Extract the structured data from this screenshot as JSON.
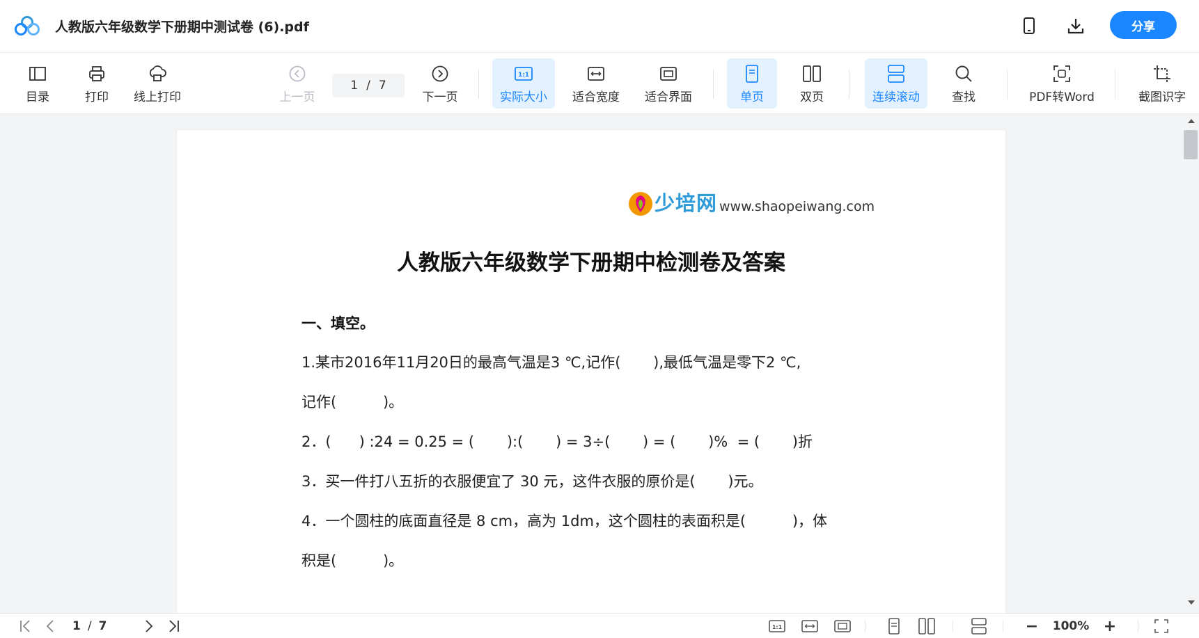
{
  "window": {
    "title": "人教版六年级数学下册期中测试卷 (6).pdf",
    "share_label": "分享",
    "accent_color": "#1a86ff"
  },
  "toolbar": {
    "toc": "目录",
    "print": "打印",
    "online_print": "线上打印",
    "prev_page": "上一页",
    "page_current": "1",
    "page_sep": "/",
    "page_total": "7",
    "next_page": "下一页",
    "actual_size": "实际大小",
    "fit_width": "适合宽度",
    "fit_screen": "适合界面",
    "single_page": "单页",
    "double_page": "双页",
    "continuous_scroll": "连续滚动",
    "find": "查找",
    "pdf_to_word": "PDF转Word",
    "screenshot_ocr": "截图识字"
  },
  "document": {
    "watermark_cn": "少培网",
    "watermark_url": "www.shaopeiwang.com",
    "title": "人教版六年级数学下册期中检测卷及答案",
    "section": "一、填空。",
    "lines": [
      "1.某市2016年11月20日的最高气温是3 ℃,记作(       ),最低气温是零下2 ℃,",
      "记作(          )。",
      "2．(      ) :24 = 0.25 = (       ):(       ) = 3÷(       ) = (       )%  = (       )折",
      "3．买一件打八五折的衣服便宜了 30 元，这件衣服的原价是(       )元。",
      "4．一个圆柱的底面直径是 8 cm，高为 1dm，这个圆柱的表面积是(          )，体",
      "积是(          )。"
    ]
  },
  "bottombar": {
    "page_current": "1",
    "page_sep": "/",
    "page_total": "7",
    "zoom_minus": "−",
    "zoom": "100%",
    "zoom_plus": "+"
  }
}
